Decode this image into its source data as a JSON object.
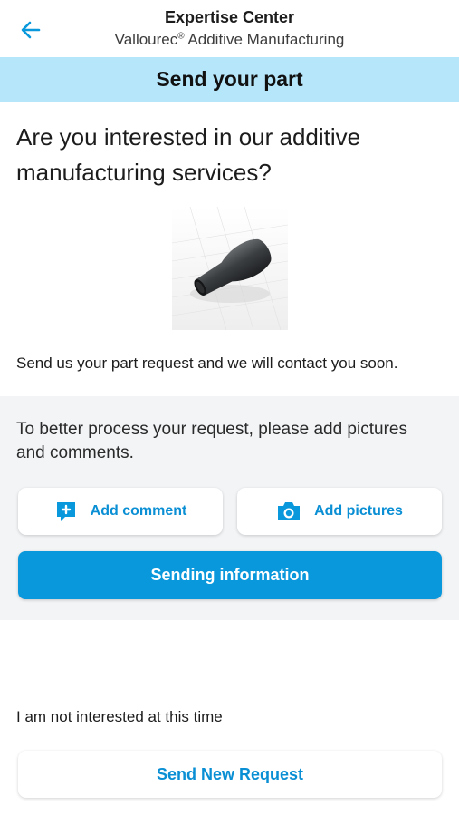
{
  "app_bar": {
    "title": "Expertise Center",
    "subtitle_brand": "Vallourec",
    "subtitle_mark": "®",
    "subtitle_rest": " Additive Manufacturing",
    "back_icon": "arrow-left-icon"
  },
  "banner": {
    "title": "Send your part"
  },
  "intro": {
    "heading": "Are you interested in our additive manufacturing services?",
    "image": "3d-part-render",
    "lead": "Send us your part request and we will contact you soon."
  },
  "details": {
    "hint": "To better process your request, please add pictures and comments.",
    "add_comment": {
      "label": "Add comment",
      "icon": "comment-plus-icon"
    },
    "add_pictures": {
      "label": "Add pictures",
      "icon": "camera-icon"
    },
    "send_label": "Sending information"
  },
  "footer": {
    "not_interested": "I am not interested at this time",
    "new_request_label": "Send New Request"
  },
  "colors": {
    "accent": "#0a98dc",
    "banner_bg": "#b6e6fa",
    "section_bg": "#f2f4f6"
  }
}
